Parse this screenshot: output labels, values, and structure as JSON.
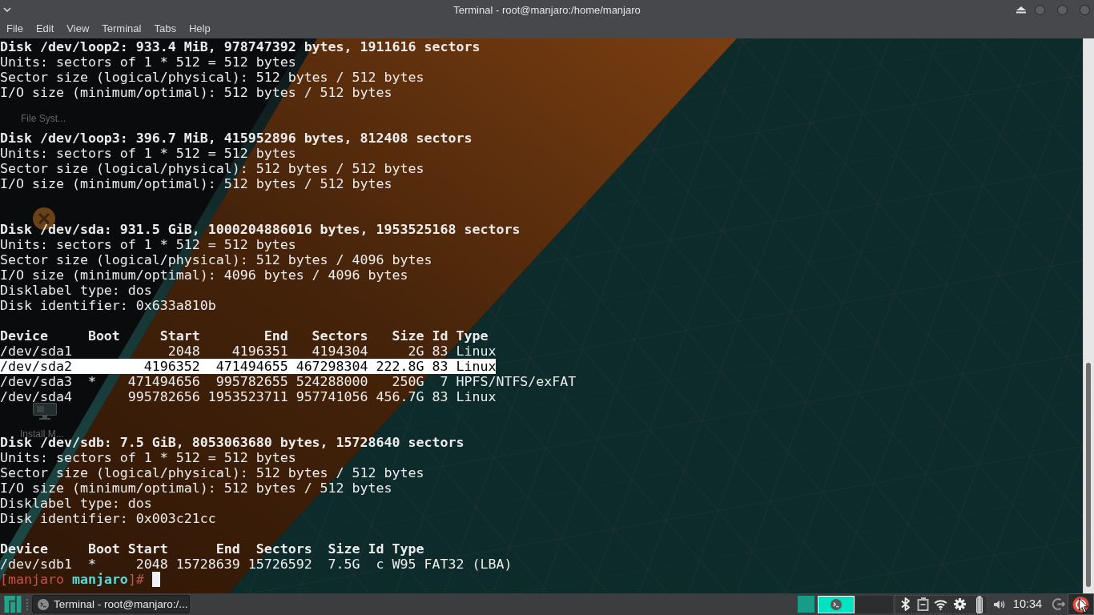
{
  "window": {
    "title": "Terminal - root@manjaro:/home/manjaro"
  },
  "menu": [
    "File",
    "Edit",
    "View",
    "Terminal",
    "Tabs",
    "Help"
  ],
  "desktop_icons": [
    {
      "label": "File Syst..."
    },
    {
      "label": "Install M..."
    }
  ],
  "terminal": {
    "lines": [
      {
        "kind": "text",
        "text": "Disk /dev/loop2: 933.4 MiB, 978747392 bytes, 1911616 sectors",
        "bold": true,
        "selected": false
      },
      {
        "kind": "text",
        "text": "Units: sectors of 1 * 512 = 512 bytes",
        "bold": false,
        "selected": false
      },
      {
        "kind": "text",
        "text": "Sector size (logical/physical): 512 bytes / 512 bytes",
        "bold": false,
        "selected": false
      },
      {
        "kind": "text",
        "text": "I/O size (minimum/optimal): 512 bytes / 512 bytes",
        "bold": false,
        "selected": false
      },
      {
        "kind": "blank"
      },
      {
        "kind": "blank"
      },
      {
        "kind": "text",
        "text": "Disk /dev/loop3: 396.7 MiB, 415952896 bytes, 812408 sectors",
        "bold": true,
        "selected": false
      },
      {
        "kind": "text",
        "text": "Units: sectors of 1 * 512 = 512 bytes",
        "bold": false,
        "selected": false
      },
      {
        "kind": "text",
        "text": "Sector size (logical/physical): 512 bytes / 512 bytes",
        "bold": false,
        "selected": false
      },
      {
        "kind": "text",
        "text": "I/O size (minimum/optimal): 512 bytes / 512 bytes",
        "bold": false,
        "selected": false
      },
      {
        "kind": "blank"
      },
      {
        "kind": "blank"
      },
      {
        "kind": "text",
        "text": "Disk /dev/sda: 931.5 GiB, 1000204886016 bytes, 1953525168 sectors",
        "bold": true,
        "selected": false
      },
      {
        "kind": "text",
        "text": "Units: sectors of 1 * 512 = 512 bytes",
        "bold": false,
        "selected": false
      },
      {
        "kind": "text",
        "text": "Sector size (logical/physical): 512 bytes / 4096 bytes",
        "bold": false,
        "selected": false
      },
      {
        "kind": "text",
        "text": "I/O size (minimum/optimal): 4096 bytes / 4096 bytes",
        "bold": false,
        "selected": false
      },
      {
        "kind": "text",
        "text": "Disklabel type: dos",
        "bold": false,
        "selected": false
      },
      {
        "kind": "text",
        "text": "Disk identifier: 0x633a810b",
        "bold": false,
        "selected": false
      },
      {
        "kind": "blank"
      },
      {
        "kind": "text",
        "text": "Device     Boot     Start        End   Sectors   Size Id Type",
        "bold": true,
        "selected": false
      },
      {
        "kind": "text",
        "text": "/dev/sda1            2048    4196351   4194304     2G 83 Linux",
        "bold": false,
        "selected": false
      },
      {
        "kind": "text",
        "text": "/dev/sda2         4196352  471494655 467298304 222.8G 83 Linux",
        "bold": false,
        "selected": true
      },
      {
        "kind": "text",
        "text": "/dev/sda3  *    471494656  995782655 524288000   250G  7 HPFS/NTFS/exFAT",
        "bold": false,
        "selected": false
      },
      {
        "kind": "text",
        "text": "/dev/sda4       995782656 1953523711 957741056 456.7G 83 Linux",
        "bold": false,
        "selected": false
      },
      {
        "kind": "blank"
      },
      {
        "kind": "blank"
      },
      {
        "kind": "text",
        "text": "Disk /dev/sdb: 7.5 GiB, 8053063680 bytes, 15728640 sectors",
        "bold": true,
        "selected": false
      },
      {
        "kind": "text",
        "text": "Units: sectors of 1 * 512 = 512 bytes",
        "bold": false,
        "selected": false
      },
      {
        "kind": "text",
        "text": "Sector size (logical/physical): 512 bytes / 512 bytes",
        "bold": false,
        "selected": false
      },
      {
        "kind": "text",
        "text": "I/O size (minimum/optimal): 512 bytes / 512 bytes",
        "bold": false,
        "selected": false
      },
      {
        "kind": "text",
        "text": "Disklabel type: dos",
        "bold": false,
        "selected": false
      },
      {
        "kind": "text",
        "text": "Disk identifier: 0x003c21cc",
        "bold": false,
        "selected": false
      },
      {
        "kind": "blank"
      },
      {
        "kind": "text",
        "text": "Device     Boot Start      End  Sectors  Size Id Type",
        "bold": true,
        "selected": false
      },
      {
        "kind": "text",
        "text": "/dev/sdb1  *     2048 15728639 15726592  7.5G  c W95 FAT32 (LBA)",
        "bold": false,
        "selected": false
      }
    ],
    "prompt": [
      {
        "kind": "user",
        "text": "[manjaro"
      },
      {
        "kind": "cwd",
        "text": " manjaro"
      },
      {
        "kind": "user",
        "text": "]#"
      }
    ]
  },
  "taskbar": {
    "tasks": [
      {
        "title": "Terminal - root@manjaro:/...",
        "selected": true
      }
    ],
    "workspaces": [
      {
        "kind": "occupied",
        "selected": false
      },
      {
        "kind": "occupied",
        "selected": true
      },
      {
        "kind": "empty",
        "selected": false
      }
    ],
    "clock": "10:34"
  }
}
